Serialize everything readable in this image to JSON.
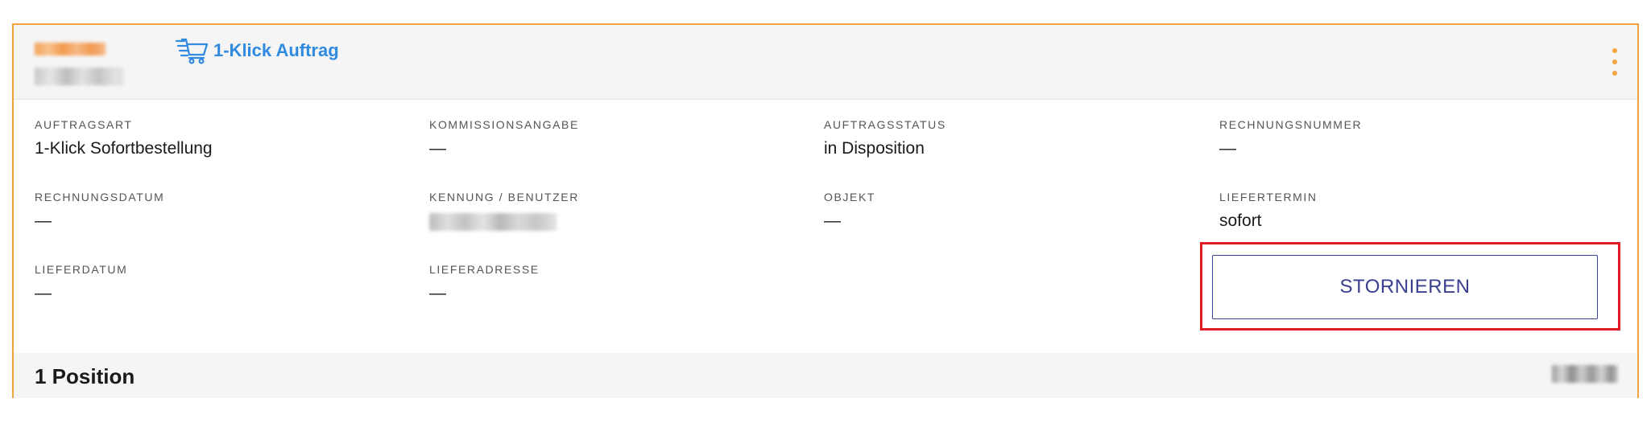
{
  "order": {
    "badge_label": "1-Klick Auftrag",
    "badge_icon": "fast-cart-icon",
    "menu_icon": "more-vertical-icon",
    "accent_color": "#f3a23c",
    "link_color": "#2f8ae0"
  },
  "fields": {
    "auftragsart": {
      "label": "AUFTRAGSART",
      "value": "1-Klick Sofortbestellung"
    },
    "kommissionsangabe": {
      "label": "KOMMISSIONSANGABE",
      "value": "—"
    },
    "auftragsstatus": {
      "label": "AUFTRAGSSTATUS",
      "value": "in Disposition"
    },
    "rechnungsnummer": {
      "label": "RECHNUNGSNUMMER",
      "value": "—"
    },
    "rechnungsdatum": {
      "label": "RECHNUNGSDATUM",
      "value": "—"
    },
    "kennung_benutzer": {
      "label": "KENNUNG / BENUTZER"
    },
    "objekt": {
      "label": "OBJEKT",
      "value": "—"
    },
    "liefertermin": {
      "label": "LIEFERTERMIN",
      "value": "sofort"
    },
    "lieferdatum": {
      "label": "LIEFERDATUM",
      "value": "—"
    },
    "lieferadresse": {
      "label": "LIEFERADRESSE",
      "value": "—"
    }
  },
  "actions": {
    "cancel_label": "STORNIEREN",
    "cancel_color": "#3a3f8f",
    "highlight_color": "#e01b24"
  },
  "footer": {
    "positions_label": "1 Position"
  }
}
